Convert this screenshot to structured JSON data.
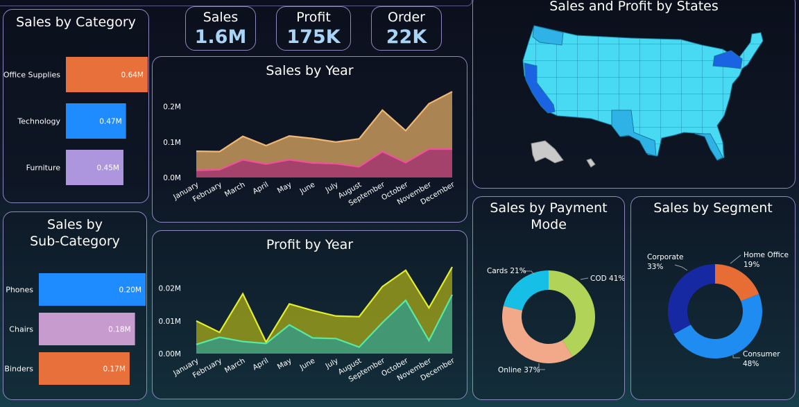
{
  "kpis": [
    {
      "label": "Sales",
      "value": "1.6M"
    },
    {
      "label": "Profit",
      "value": "175K"
    },
    {
      "label": "Order",
      "value": "22K"
    }
  ],
  "colors": {
    "panel_border": "#8f88c0",
    "title": "#ffffff",
    "kpi_value": "#a8d4f7"
  },
  "chart_data": [
    {
      "id": "category",
      "type": "bar",
      "orientation": "horizontal",
      "title": "Sales by Category",
      "categories": [
        "Office Supplies",
        "Technology",
        "Furniture"
      ],
      "values": [
        0.64,
        0.47,
        0.45
      ],
      "value_labels": [
        "0.64M",
        "0.47M",
        "0.45M"
      ],
      "colors": [
        "#e8703a",
        "#1e8cff",
        "#ad96de"
      ],
      "xlim": [
        0,
        0.64
      ]
    },
    {
      "id": "subcategory",
      "type": "bar",
      "orientation": "horizontal",
      "title": "Sales by Sub-Category",
      "title_lines": [
        "Sales by",
        "Sub-Category"
      ],
      "categories": [
        "Phones",
        "Chairs",
        "Binders"
      ],
      "values": [
        0.2,
        0.18,
        0.17
      ],
      "value_labels": [
        "0.20M",
        "0.18M",
        "0.17M"
      ],
      "colors": [
        "#1e8cff",
        "#c89bcf",
        "#e8703a"
      ],
      "xlim": [
        0,
        0.2
      ]
    },
    {
      "id": "sales_year",
      "type": "area",
      "title": "Sales by Year",
      "x": [
        "January",
        "February",
        "March",
        "April",
        "May",
        "June",
        "July",
        "August",
        "September",
        "October",
        "November",
        "December"
      ],
      "series": [
        {
          "values": [
            0.074,
            0.073,
            0.116,
            0.09,
            0.117,
            0.11,
            0.1,
            0.109,
            0.19,
            0.132,
            0.208,
            0.242
          ],
          "stroke": "#f1b873",
          "fill": "#b38a55"
        },
        {
          "values": [
            0.02,
            0.022,
            0.05,
            0.038,
            0.05,
            0.041,
            0.039,
            0.03,
            0.073,
            0.042,
            0.08,
            0.08
          ],
          "stroke": "#f0509c",
          "fill": "#a33b6e"
        }
      ],
      "ylim": [
        0,
        0.26
      ],
      "yticks": [
        0,
        0.1,
        0.2
      ],
      "ytick_labels": [
        "0.0M",
        "0.1M",
        "0.2M"
      ]
    },
    {
      "id": "profit_year",
      "type": "area",
      "title": "Profit by Year",
      "x": [
        "January",
        "February",
        "March",
        "April",
        "May",
        "June",
        "July",
        "August",
        "September",
        "October",
        "November",
        "December"
      ],
      "series": [
        {
          "values": [
            0.01,
            0.0065,
            0.0183,
            0.0035,
            0.0152,
            0.0132,
            0.0115,
            0.0113,
            0.0205,
            0.0255,
            0.014,
            0.0265
          ],
          "stroke": "#e4ee2e",
          "fill": "#898e1e"
        },
        {
          "values": [
            0.0028,
            0.005,
            0.0037,
            0.0031,
            0.0088,
            0.0048,
            0.0046,
            0.002,
            0.0095,
            0.0163,
            0.004,
            0.018
          ],
          "stroke": "#55eaa6",
          "fill": "#3c9a7c"
        }
      ],
      "ylim": [
        0,
        0.028
      ],
      "yticks": [
        0,
        0.01,
        0.02
      ],
      "ytick_labels": [
        "0.00M",
        "0.01M",
        "0.02M"
      ]
    },
    {
      "id": "payment",
      "type": "pie",
      "donut": true,
      "title": "Sales by Payment Mode",
      "title_lines": [
        "Sales by Payment",
        "Mode"
      ],
      "categories": [
        "COD",
        "Online",
        "Cards"
      ],
      "values": [
        41,
        37,
        21
      ],
      "labels": [
        "COD 41%",
        "Online 37%",
        "Cards 21%"
      ],
      "colors": [
        "#b1d357",
        "#f2a98a",
        "#16bfe6"
      ]
    },
    {
      "id": "segment",
      "type": "pie",
      "donut": true,
      "title": "Sales by Segment",
      "categories": [
        "Home Office",
        "Consumer",
        "Corporate"
      ],
      "values": [
        19,
        48,
        33
      ],
      "labels": [
        [
          "Home Office",
          "19%"
        ],
        [
          "Consumer",
          "48%"
        ],
        [
          "Corporate",
          "33%"
        ]
      ],
      "colors": [
        "#e86d35",
        "#1f8cf2",
        "#1729a2"
      ]
    }
  ],
  "map": {
    "title": "Sales and Profit by States",
    "colors": {
      "base": "#48d9f3",
      "mid": "#2fb3e6",
      "high": "#1a63e2",
      "alaska": "#c9c9c9"
    }
  }
}
